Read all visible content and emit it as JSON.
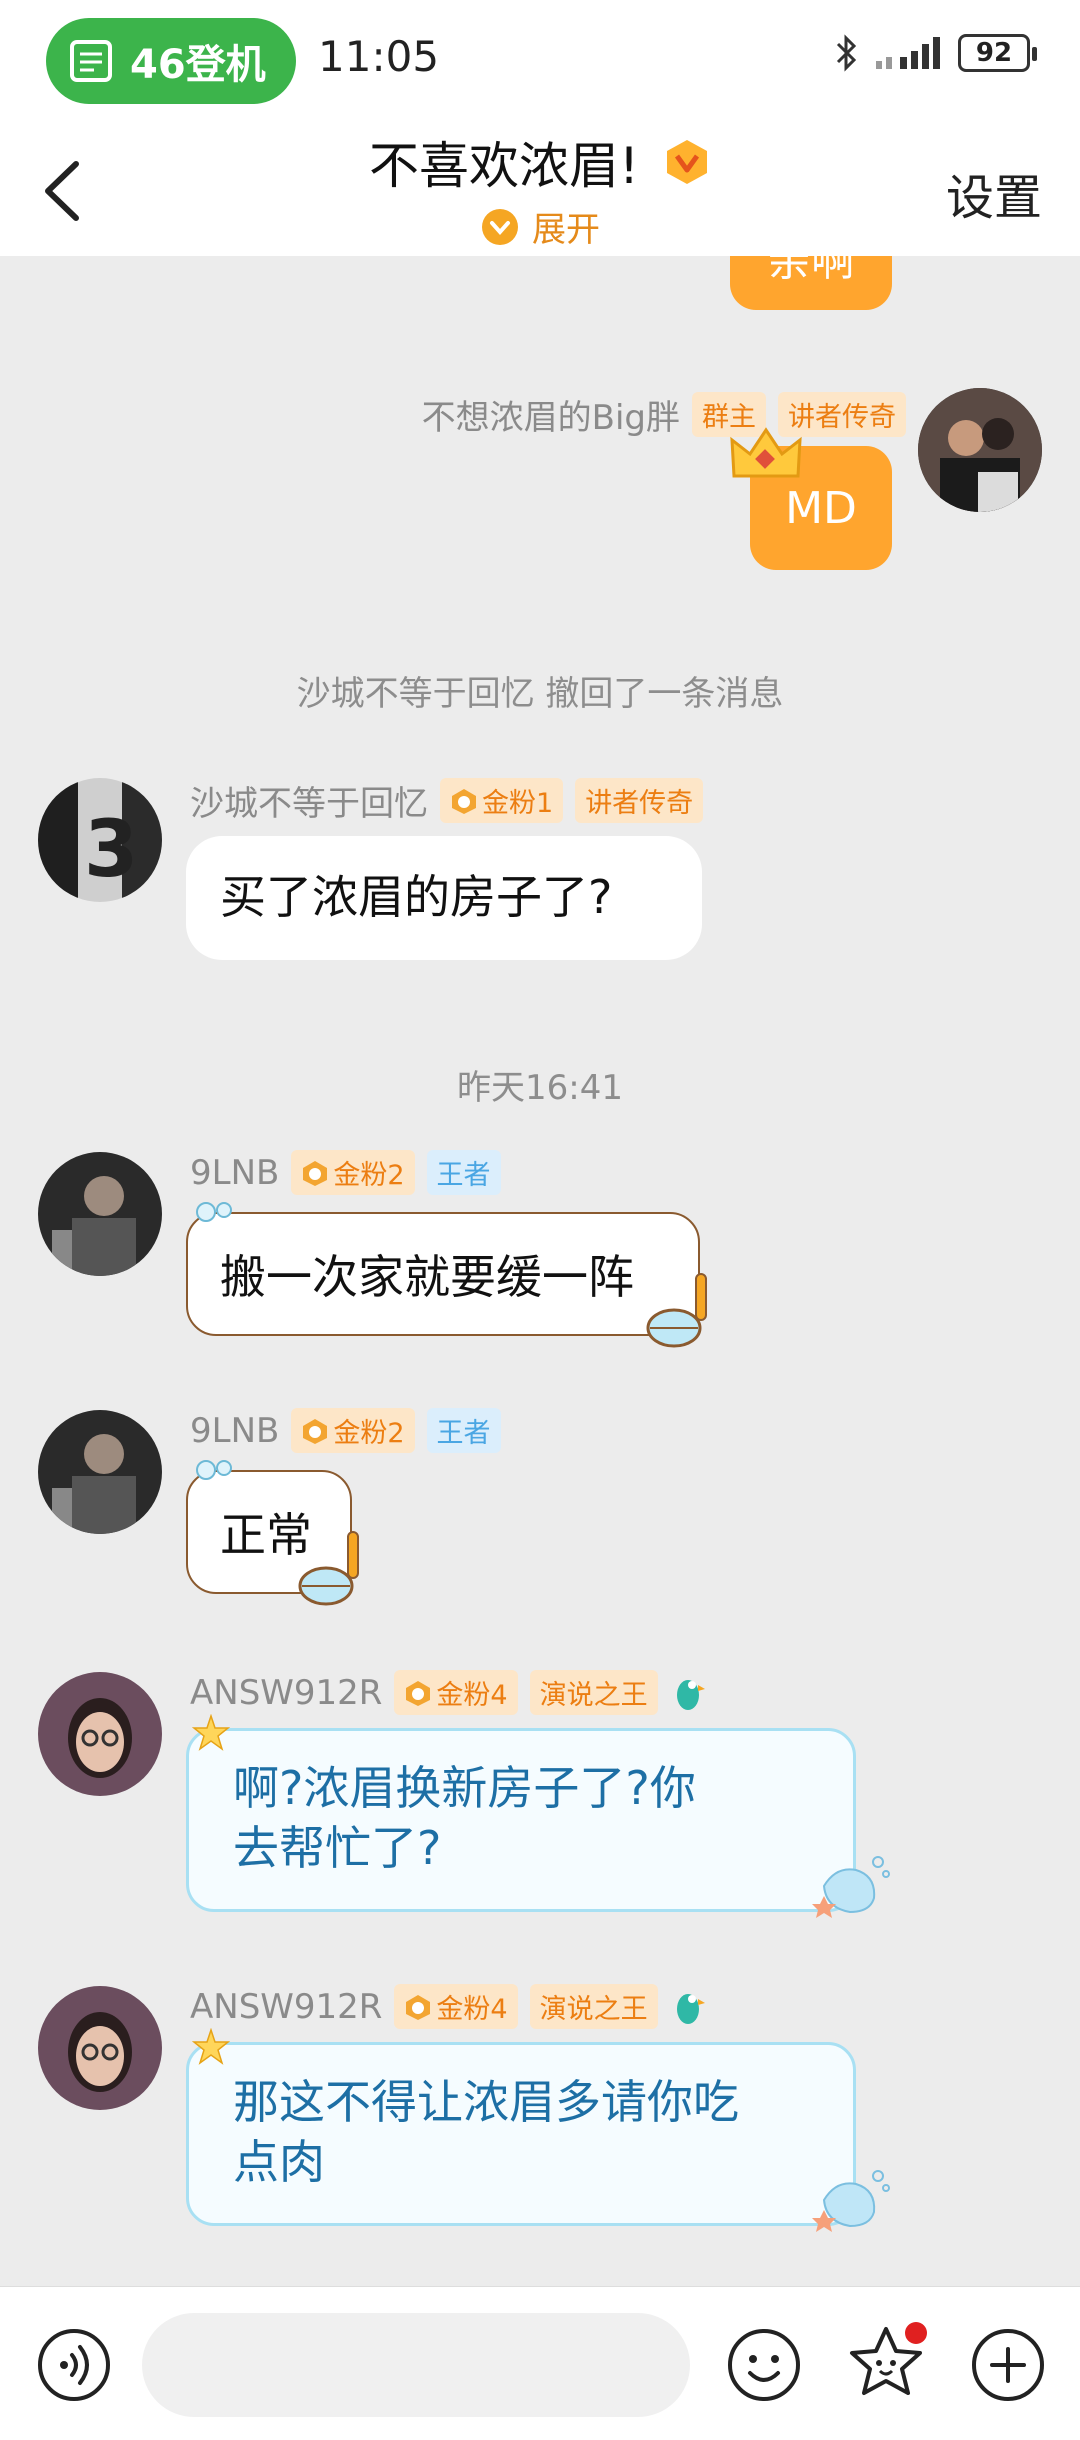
{
  "status_bar": {
    "pill_text": "46登机",
    "time": "11:05",
    "battery": "92"
  },
  "header": {
    "title": "不喜欢浓眉!",
    "expand_label": "展开",
    "settings_label": "设置"
  },
  "messages": {
    "m0": {
      "text": "亲啊"
    },
    "m1": {
      "sender": "不想浓眉的Big胖",
      "tags": [
        "群主",
        "讲者传奇"
      ],
      "text": "MD"
    },
    "m2": {
      "system": "沙城不等于回忆 撤回了一条消息"
    },
    "m3": {
      "sender": "沙城不等于回忆",
      "tags": [
        "金粉1",
        "讲者传奇"
      ],
      "text": "买了浓眉的房子了?"
    },
    "m4": {
      "system": "昨天16:41"
    },
    "m5": {
      "sender": "9LNB",
      "tags": [
        "金粉2",
        "王者"
      ],
      "text": "搬一次家就要缓一阵"
    },
    "m6": {
      "sender": "9LNB",
      "tags": [
        "金粉2",
        "王者"
      ],
      "text": "正常"
    },
    "m7": {
      "sender": "ANSW912R",
      "tags": [
        "金粉4",
        "演说之王"
      ],
      "text_line1": "啊?浓眉换新房子了?你",
      "text_line2": "去帮忙了?"
    },
    "m8": {
      "sender": "ANSW912R",
      "tags": [
        "金粉4",
        "演说之王"
      ],
      "text_line1": "那这不得让浓眉多请你吃",
      "text_line2": "点肉"
    }
  },
  "input": {
    "placeholder": ""
  },
  "icons": {
    "back": "chevron-left-icon",
    "voice": "voice-icon",
    "emoji": "emoji-icon",
    "star": "star-face-icon",
    "plus": "plus-icon"
  },
  "colors": {
    "accent_orange": "#ffa52e",
    "pill_green": "#3cb44b",
    "ocean_text": "#1d6fa5",
    "notification_red": "#e02020"
  }
}
